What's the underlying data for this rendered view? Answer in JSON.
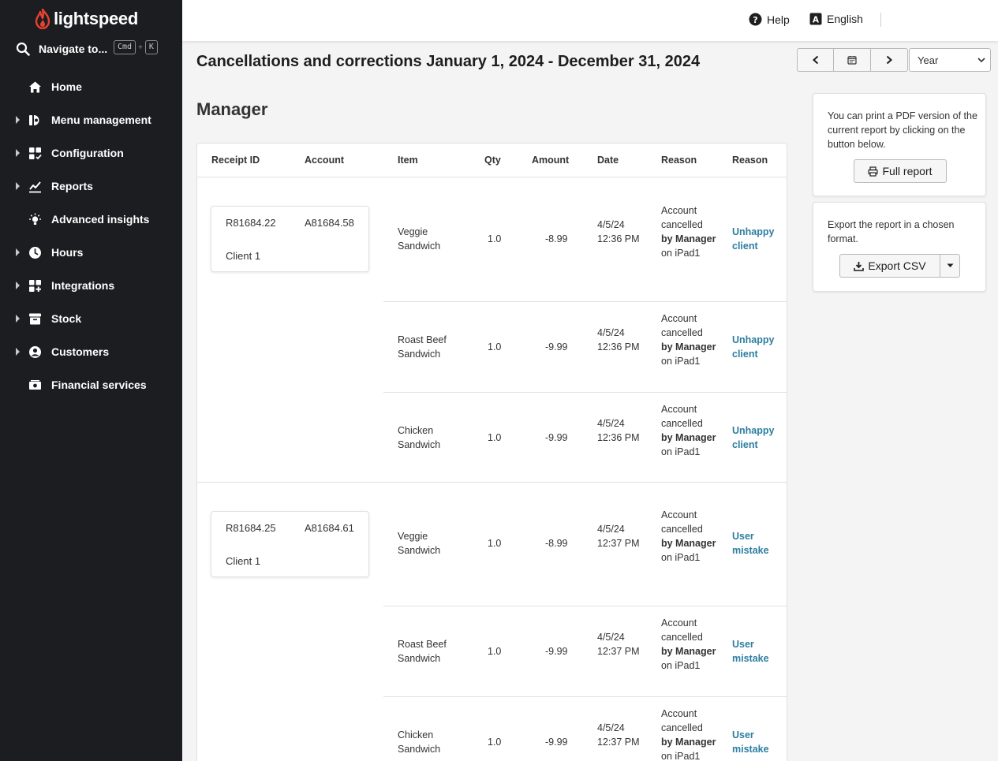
{
  "brand": {
    "name": "lightspeed"
  },
  "navigate": {
    "label": "Navigate to...",
    "key1": "Cmd",
    "plus": "+",
    "key2": "K"
  },
  "sidebar": {
    "items": [
      {
        "label": "Home",
        "icon": "home-icon",
        "expandable": false
      },
      {
        "label": "Menu management",
        "icon": "menu-management-icon",
        "expandable": true
      },
      {
        "label": "Configuration",
        "icon": "configuration-icon",
        "expandable": true
      },
      {
        "label": "Reports",
        "icon": "reports-icon",
        "expandable": true
      },
      {
        "label": "Advanced insights",
        "icon": "lightbulb-icon",
        "expandable": false
      },
      {
        "label": "Hours",
        "icon": "clock-icon",
        "expandable": true
      },
      {
        "label": "Integrations",
        "icon": "integrations-icon",
        "expandable": true
      },
      {
        "label": "Stock",
        "icon": "stock-icon",
        "expandable": true
      },
      {
        "label": "Customers",
        "icon": "customer-icon",
        "expandable": true
      },
      {
        "label": "Financial services",
        "icon": "money-icon",
        "expandable": false
      }
    ]
  },
  "topbar": {
    "help_label": "Help",
    "language_label": "English"
  },
  "page": {
    "title": "Cancellations and corrections January 1, 2024 - December 31, 2024",
    "period_select": "Year",
    "section_title": "Manager"
  },
  "table": {
    "headers": [
      "Receipt ID",
      "Account",
      "Item",
      "Qty",
      "Amount",
      "Date",
      "Reason",
      "Reason"
    ],
    "groups": [
      {
        "receipt_id": "R81684.22",
        "account": "A81684.58",
        "client": "Client 1",
        "lines": [
          {
            "item": "Veggie Sandwich",
            "qty": "1.0",
            "amount": "-8.99",
            "date": "4/5/24 12:36 PM",
            "reason_pre": "Account cancelled",
            "reason_by": "by Manager",
            "reason_post": "on iPad1",
            "reason_link": "Unhappy client"
          },
          {
            "item": "Roast Beef Sandwich",
            "qty": "1.0",
            "amount": "-9.99",
            "date": "4/5/24 12:36 PM",
            "reason_pre": "Account cancelled",
            "reason_by": "by Manager",
            "reason_post": "on iPad1",
            "reason_link": "Unhappy client"
          },
          {
            "item": "Chicken Sandwich",
            "qty": "1.0",
            "amount": "-9.99",
            "date": "4/5/24 12:36 PM",
            "reason_pre": "Account cancelled",
            "reason_by": "by Manager",
            "reason_post": "on iPad1",
            "reason_link": "Unhappy client"
          }
        ]
      },
      {
        "receipt_id": "R81684.25",
        "account": "A81684.61",
        "client": "Client 1",
        "lines": [
          {
            "item": "Veggie Sandwich",
            "qty": "1.0",
            "amount": "-8.99",
            "date": "4/5/24 12:37 PM",
            "reason_pre": "Account cancelled",
            "reason_by": "by Manager",
            "reason_post": "on iPad1",
            "reason_link": "User mistake"
          },
          {
            "item": "Roast Beef Sandwich",
            "qty": "1.0",
            "amount": "-9.99",
            "date": "4/5/24 12:37 PM",
            "reason_pre": "Account cancelled",
            "reason_by": "by Manager",
            "reason_post": "on iPad1",
            "reason_link": "User mistake"
          },
          {
            "item": "Chicken Sandwich",
            "qty": "1.0",
            "amount": "-9.99",
            "date": "4/5/24 12:37 PM",
            "reason_pre": "Account cancelled",
            "reason_by": "by Manager",
            "reason_post": "on iPad1",
            "reason_link": "User mistake"
          }
        ]
      }
    ]
  },
  "print_panel": {
    "text": "You can print a PDF version of the current report by clicking on the button below.",
    "button_label": "Full report"
  },
  "export_panel": {
    "text": "Export the report in a chosen format.",
    "button_label": "Export CSV"
  },
  "colors": {
    "sidebar_bg": "#1c1d21",
    "link": "#2d7ea0",
    "brand_red": "#e8412f"
  }
}
